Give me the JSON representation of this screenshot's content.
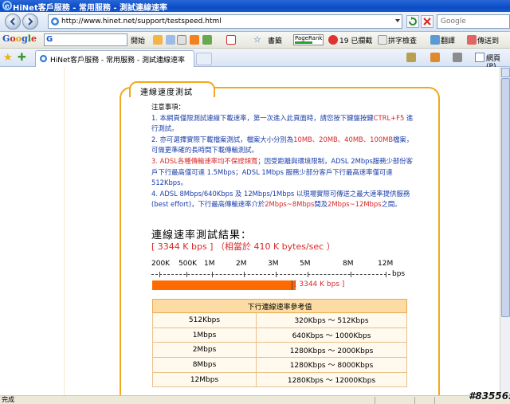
{
  "window": {
    "title": "HiNet客戶服務 - 常用服務 - 測試連線速率"
  },
  "address_bar": {
    "url": "http://www.hinet.net/support/testspeed.html",
    "search_placeholder": "Google"
  },
  "google_toolbar": {
    "logo": "Google",
    "start_label": "開始",
    "bookmarks_label": "書籤",
    "pagerank_label": "PageRank",
    "blocked_label": "19 已攔截",
    "spellcheck_label": "拼字檢查",
    "translate_label": "翻譯",
    "send_label": "傳送到"
  },
  "tab_bar": {
    "tab_label": "HiNet客戶服務 - 常用服務 - 測試連線速率",
    "page_menu": "網頁(P)"
  },
  "panel": {
    "heading": "連線速度測試"
  },
  "notes": {
    "title": "注意事項：",
    "n1a": "1. 本網頁僅限測試連線下載速率，第一次進入此頁面時，請您按下鍵盤按鍵",
    "n1b": "CTRL+F5",
    "n1c": " 進行測試。",
    "n2a": "2. 亦可選擇實際下載檔案測試，檔案大小分別為",
    "n2b": "10MB、20MB、40MB、100MB",
    "n2c": "檔案，可做更準確的長時間下載傳輸測試。",
    "n3a": "3. ADSL各種傳輸速率均不保證頻寬",
    "n3b": "；因受距離與環境限制，ADSL 2Mbps服務少部份客戶下行最高僅可達 1.5Mbps；ADSL 1Mbps 服務少部分客戶下行最高速率僅可達512Kbps。",
    "n4a": "4. ADSL 8Mbps/640Kbps 及 12Mbps/1Mbps 以現場實際可傳送之最大速率提供服務(best effort)，下行最高傳輸速率介於",
    "n4b": "2Mbps~8Mbps",
    "n4c": "間及",
    "n4d": "2Mbps~12Mbps",
    "n4e": "之間。"
  },
  "result": {
    "title": "連線速率測試結果：",
    "value_line": "[ 3344 K bps ] （相當於 410 K bytes/sec ）",
    "bar_value_kbps": 3344,
    "bar_label": "[ 3344 K bps ]",
    "unit": "bps",
    "scale_ticks": [
      "200K",
      "500K",
      "1M",
      "2M",
      "3M",
      "5M",
      "8M",
      "12M"
    ]
  },
  "reference_table": {
    "header": "下行連線速率參考值",
    "rows": [
      {
        "plan": "512Kbps",
        "range": "320Kbps  ～  512Kbps"
      },
      {
        "plan": "1Mbps",
        "range": "640Kbps  ～  1000Kbps"
      },
      {
        "plan": "2Mbps",
        "range": "1280Kbps  ～  2000Kbps"
      },
      {
        "plan": "8Mbps",
        "range": "1280Kbps  ～  8000Kbps"
      },
      {
        "plan": "12Mbps",
        "range": "1280Kbps  ～  12000Kbps"
      }
    ]
  },
  "status_bar": {
    "text": "完成",
    "watermark": "#835565"
  },
  "colors": {
    "accent_orange": "#f2a81f",
    "bar_orange": "#ff6a00",
    "red_text": "#d8282a",
    "blue_text": "#1a3da8"
  }
}
